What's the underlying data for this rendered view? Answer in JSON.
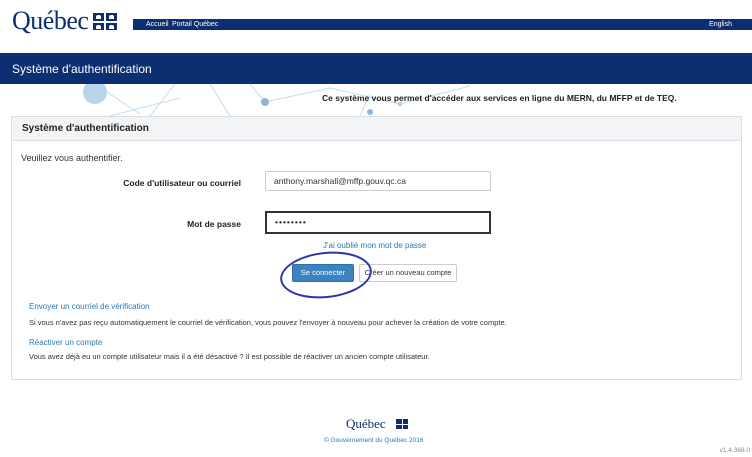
{
  "header": {
    "logo_text": "Québec",
    "nav": {
      "accueil": "Accueil",
      "portail": "Portail Québec",
      "english": "English"
    }
  },
  "banner": {
    "title": "Système d'authentification",
    "tagline": "Ce système vous permet d'accéder aux services en ligne du MERN, du MFFP et de TEQ."
  },
  "panel": {
    "title": "Système d'authentification",
    "intro": "Veuillez vous authentifier.",
    "user_label": "Code d'utilisateur ou courriel",
    "user_value": "anthony.marshall@mffp.gouv.qc.ca",
    "password_label": "Mot de passe",
    "password_value": "••••••••",
    "forgot_link": "J'ai oublié mon mot de passe",
    "login_button": "Se connecter",
    "create_button": "Créer un nouveau compte",
    "verif_link": "Envoyer un courriel de vérification",
    "verif_desc": "Si vous n'avez pas reçu automatiquement le courriel de vérification, vous pouvez l'envoyer à nouveau pour achever la création de votre compte.",
    "react_link": "Réactiver un compte",
    "react_desc": "Vous avez déjà eu un compte utilisateur mais il a été désactivé ? Il est possible de réactiver un ancien compte utilisateur."
  },
  "footer": {
    "logo_text": "Québec",
    "copyright": "© Gouvernement du Québec 2016",
    "version": "v1.4.368.0"
  },
  "colors": {
    "brand_blue": "#0b2f70",
    "link_blue": "#2a7ab8",
    "button_blue": "#3d83c2"
  }
}
